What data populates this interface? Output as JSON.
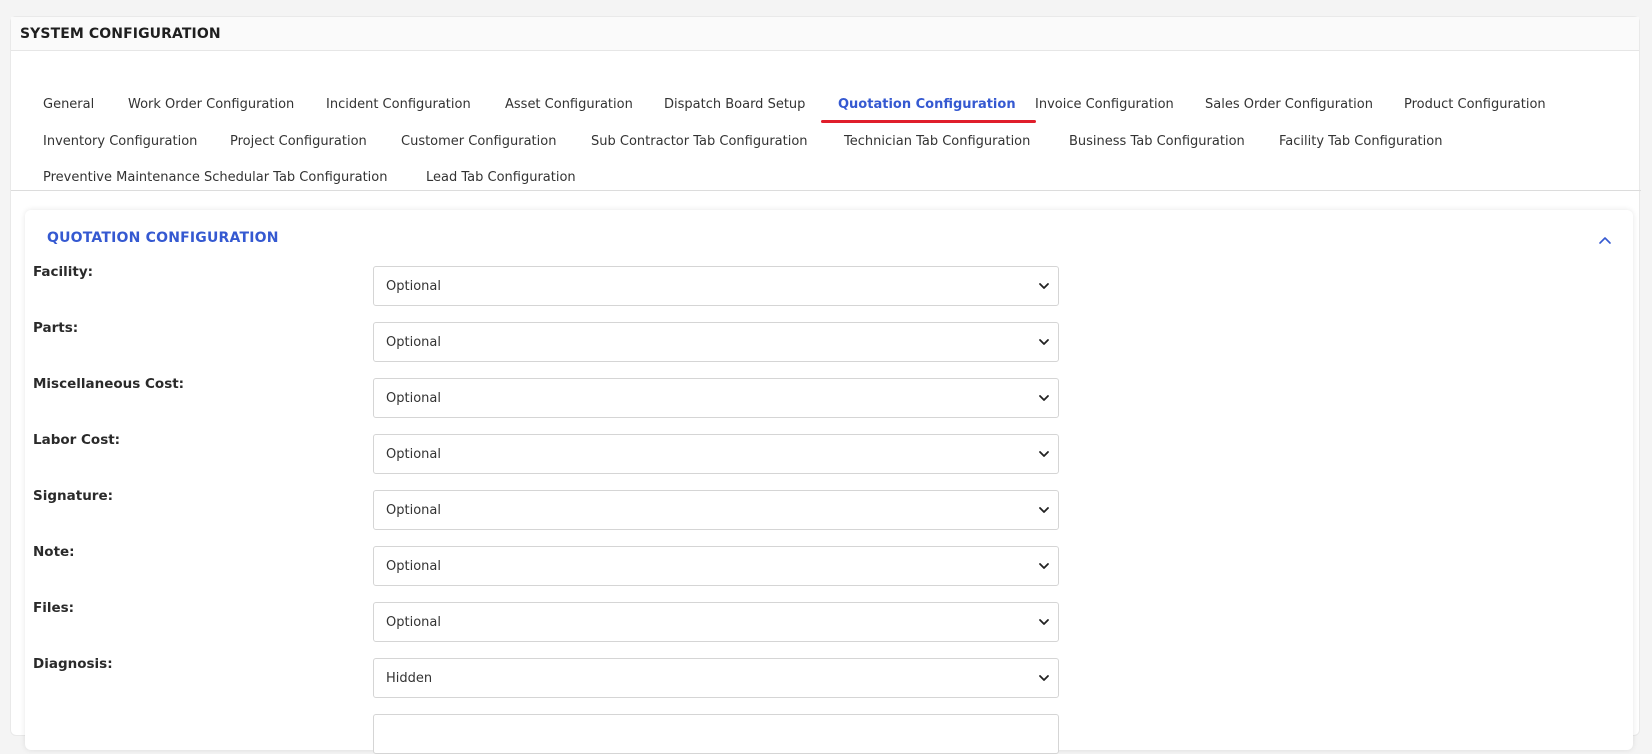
{
  "page": {
    "title": "SYSTEM CONFIGURATION"
  },
  "tabs": [
    {
      "label": "General"
    },
    {
      "label": "Work Order Configuration"
    },
    {
      "label": "Incident Configuration"
    },
    {
      "label": "Asset Configuration"
    },
    {
      "label": "Dispatch Board Setup"
    },
    {
      "label": "Quotation Configuration",
      "active": true
    },
    {
      "label": "Invoice Configuration"
    },
    {
      "label": "Sales Order Configuration"
    },
    {
      "label": "Product Configuration"
    },
    {
      "label": "Inventory Configuration"
    },
    {
      "label": "Project Configuration"
    },
    {
      "label": "Customer Configuration"
    },
    {
      "label": "Sub Contractor Tab Configuration"
    },
    {
      "label": "Technician Tab Configuration"
    },
    {
      "label": "Business Tab Configuration"
    },
    {
      "label": "Facility Tab Configuration"
    },
    {
      "label": "Preventive Maintenance Schedular Tab Configuration"
    },
    {
      "label": "Lead Tab Configuration"
    }
  ],
  "section": {
    "title": "QUOTATION CONFIGURATION",
    "fields": [
      {
        "label": "Facility:",
        "value": "Optional"
      },
      {
        "label": "Parts:",
        "value": "Optional"
      },
      {
        "label": "Miscellaneous Cost:",
        "value": "Optional"
      },
      {
        "label": "Labor Cost:",
        "value": "Optional"
      },
      {
        "label": "Signature:",
        "value": "Optional"
      },
      {
        "label": "Note:",
        "value": "Optional"
      },
      {
        "label": "Files:",
        "value": "Optional"
      },
      {
        "label": "Diagnosis:",
        "value": "Hidden"
      },
      {
        "label": "",
        "value": ""
      }
    ]
  },
  "colors": {
    "accent": "#3559d1",
    "active_underline": "#e01e2b"
  },
  "icons": {
    "collapse": "chevron-up-icon",
    "select_arrow": "chevron-down-icon"
  }
}
